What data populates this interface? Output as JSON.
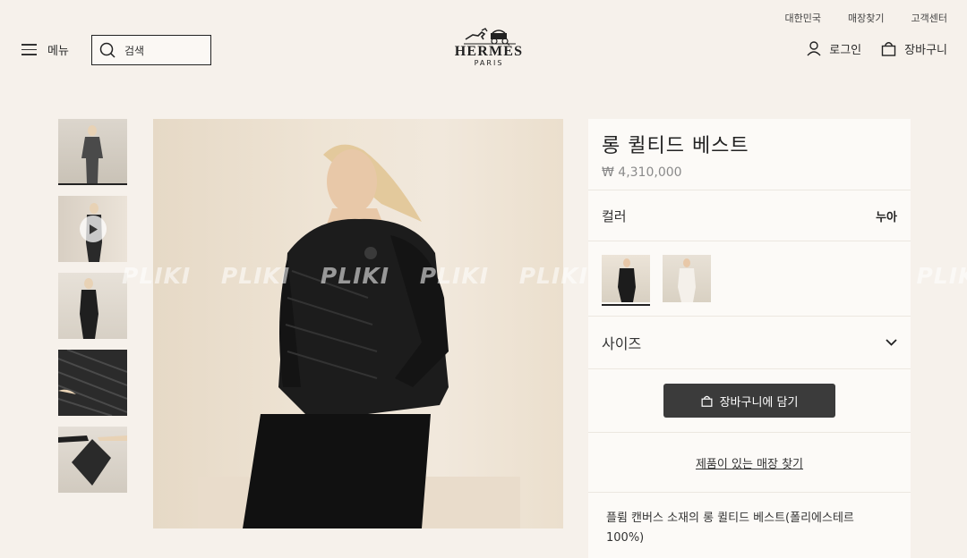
{
  "util_nav": [
    "대한민국",
    "매장찾기",
    "고객센터"
  ],
  "header": {
    "menu_label": "메뉴",
    "search_value": "검색",
    "logo_brand": "HERMÈS",
    "logo_city": "PARIS",
    "login_label": "로그인",
    "cart_label": "장바구니"
  },
  "watermark": "PLIKI PLIKI PLIKI PLIKI PLIKI PLIKI PLIKI PLIKI PLIKI",
  "product": {
    "title": "롱 퀼티드 베스트",
    "price": "₩ 4,310,000",
    "color_label": "컬러",
    "color_value": "누아",
    "size_label": "사이즈",
    "add_to_cart": "장바구니에 담기",
    "find_store": "제품이 있는 매장 찾기",
    "description": "플륌 캔버스 소재의 롱 퀼티드 베스트(폴리에스테르 100%)"
  },
  "colors": {
    "accent_dark": "#3b3b3b",
    "background": "#f6f1eb",
    "panel": "#fcfaf7"
  }
}
